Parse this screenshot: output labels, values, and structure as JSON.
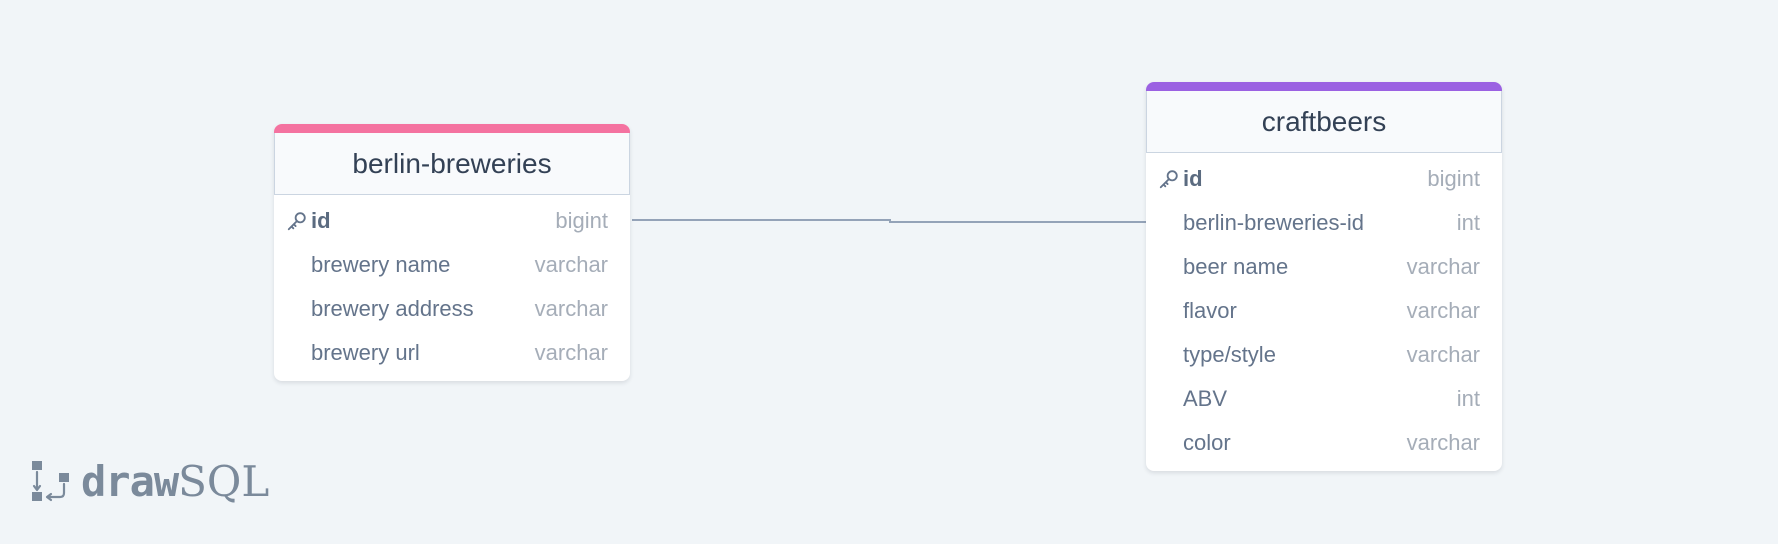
{
  "tables": [
    {
      "title": "berlin-breweries",
      "accent": "#f472a0",
      "columns": [
        {
          "name": "id",
          "type": "bigint",
          "pk": true
        },
        {
          "name": "brewery name",
          "type": "varchar",
          "pk": false
        },
        {
          "name": "brewery address",
          "type": "varchar",
          "pk": false
        },
        {
          "name": "brewery url",
          "type": "varchar",
          "pk": false
        }
      ]
    },
    {
      "title": "craftbeers",
      "accent": "#9b61e2",
      "columns": [
        {
          "name": "id",
          "type": "bigint",
          "pk": true
        },
        {
          "name": "berlin-breweries-id",
          "type": "int",
          "pk": false
        },
        {
          "name": "beer name",
          "type": "varchar",
          "pk": false
        },
        {
          "name": "flavor",
          "type": "varchar",
          "pk": false
        },
        {
          "name": "type/style",
          "type": "varchar",
          "pk": false
        },
        {
          "name": "ABV",
          "type": "int",
          "pk": false
        },
        {
          "name": "color",
          "type": "varchar",
          "pk": false
        }
      ]
    }
  ],
  "relationship": {
    "from_table": "berlin-breweries",
    "from_column": "id",
    "to_table": "craftbeers",
    "to_column": "berlin-breweries-id"
  },
  "logo": {
    "bold": "draw",
    "light": "SQL"
  },
  "colors": {
    "background": "#f1f5f8",
    "connector": "#94a3b8"
  },
  "icons": {
    "primary_key": "key-icon",
    "logo": "drawsql-logo-icon"
  }
}
